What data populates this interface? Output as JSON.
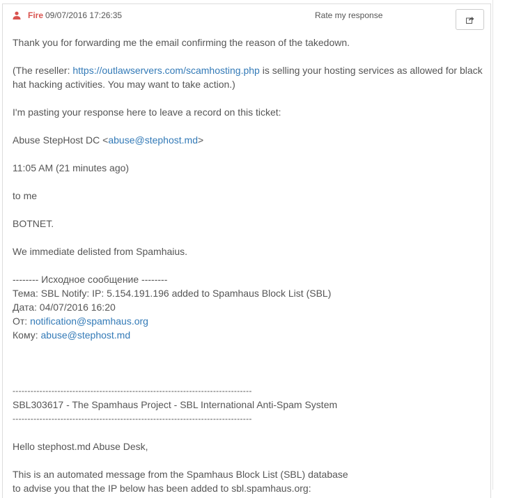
{
  "header": {
    "author": "Fire",
    "timestamp": "09/07/2016 17:26:35",
    "rate_label": "Rate my response"
  },
  "icons": {
    "user": "user-icon",
    "share": "share-icon"
  },
  "colors": {
    "author": "#d9534f",
    "link": "#337ab7",
    "text": "#555555"
  },
  "message": {
    "line1": "Thank you for forwarding me the email confirming the reason of the takedown.",
    "reseller_prefix": "(The reseller: ",
    "reseller_link": "https://outlawservers.com/scamhosting.php",
    "reseller_suffix": " is selling your hosting services as allowed for black hat hacking activities. You may want to take action.)",
    "pasting": "I'm pasting your response here to leave a record on this ticket:",
    "from_name": "Abuse StepHost DC <",
    "from_email": "abuse@stephost.md",
    "from_close": ">",
    "time": "11:05 AM (21 minutes ago)",
    "to_me": "to me",
    "botnet": "BOTNET.",
    "delisted": "We immediate delisted from Spamhaius.",
    "orig_header": "-------- Исходное сообщение --------",
    "subject": "Тема: SBL Notify: IP: 5.154.191.196 added to Spamhaus Block List (SBL)",
    "date": "Дата: 04/07/2016 16:20",
    "from_label": "От: ",
    "from_link": "notification@spamhaus.org",
    "to_label": "Кому: ",
    "to_link": "abuse@stephost.md",
    "divider": "--------------------------------------------------------------------------------",
    "sbl_title": "SBL303617 - The Spamhaus Project - SBL International Anti-Spam System",
    "hello": "Hello stephost.md Abuse Desk,",
    "auto1": "This is an automated message from the Spamhaus Block List (SBL) database",
    "auto2": "to advise you that the IP below has been added to sbl.spamhaus.org:"
  }
}
